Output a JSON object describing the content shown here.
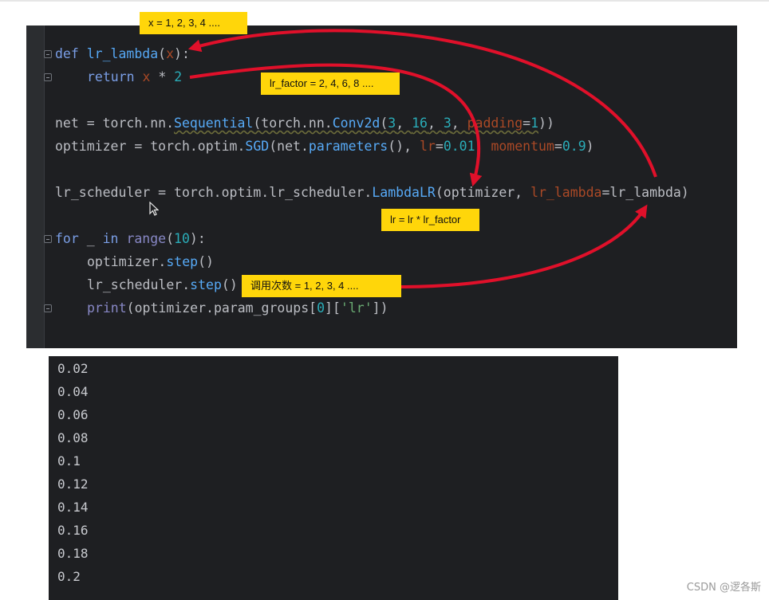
{
  "code_lines": {
    "l1": {
      "def": "def",
      "name": "lr_lambda",
      "open": "(",
      "param": "x",
      "close": "):"
    },
    "l2": {
      "ret": "return",
      "x": "x",
      "op": " * ",
      "two": "2"
    },
    "l3": {
      "a": "net = torch.nn.",
      "seq": "Sequential",
      "b": "(torch.nn.",
      "conv": "Conv2d",
      "c": "(",
      "n1": "3",
      "d": ", ",
      "n2": "16",
      "e": ", ",
      "n3": "3",
      "f": ", ",
      "kw": "padding",
      "g": "=",
      "n4": "1",
      "h": "))"
    },
    "l4": {
      "a": "optimizer = torch.optim.",
      "sgd": "SGD",
      "b": "(net.",
      "params": "parameters",
      "c": "(), ",
      "kw1": "lr",
      "eq1": "=",
      "v1": "0.01",
      "d": ", ",
      "kw2": "momentum",
      "eq2": "=",
      "v2": "0.9",
      "e": ")"
    },
    "l5": {
      "a": "lr_scheduler = torch.optim.lr_scheduler.",
      "cls": "LambdaLR",
      "b": "(optimizer, ",
      "kw": "lr_lambda",
      "c": "=lr_lambda)"
    },
    "l6": {
      "for": "for",
      "a": " _ ",
      "in": "in",
      "b": " ",
      "range": "range",
      "c": "(",
      "n": "10",
      "d": "):"
    },
    "l7": {
      "a": "optimizer.",
      "step": "step",
      "b": "()"
    },
    "l8": {
      "a": "lr_scheduler.",
      "step": "step",
      "b": "()"
    },
    "l9": {
      "print": "print",
      "a": "(optimizer.param_groups[",
      "n": "0",
      "b": "][",
      "s": "'lr'",
      "c": "])"
    }
  },
  "annotations": {
    "x_values": "x = 1, 2, 3, 4 ....",
    "lr_factor": "lr_factor = 2, 4, 6, 8 ....",
    "lr_formula": "lr = lr * lr_factor",
    "call_count": "调用次数 = 1, 2, 3, 4 ...."
  },
  "output_lines": [
    "0.02",
    "0.04",
    "0.06",
    "0.08",
    "0.1",
    "0.12",
    "0.14",
    "0.16",
    "0.18",
    "0.2"
  ],
  "watermark": "CSDN @逻各斯",
  "colors": {
    "editor_bg": "#1e1f22",
    "note_bg": "#ffd60a",
    "arrow": "#e0102a"
  }
}
